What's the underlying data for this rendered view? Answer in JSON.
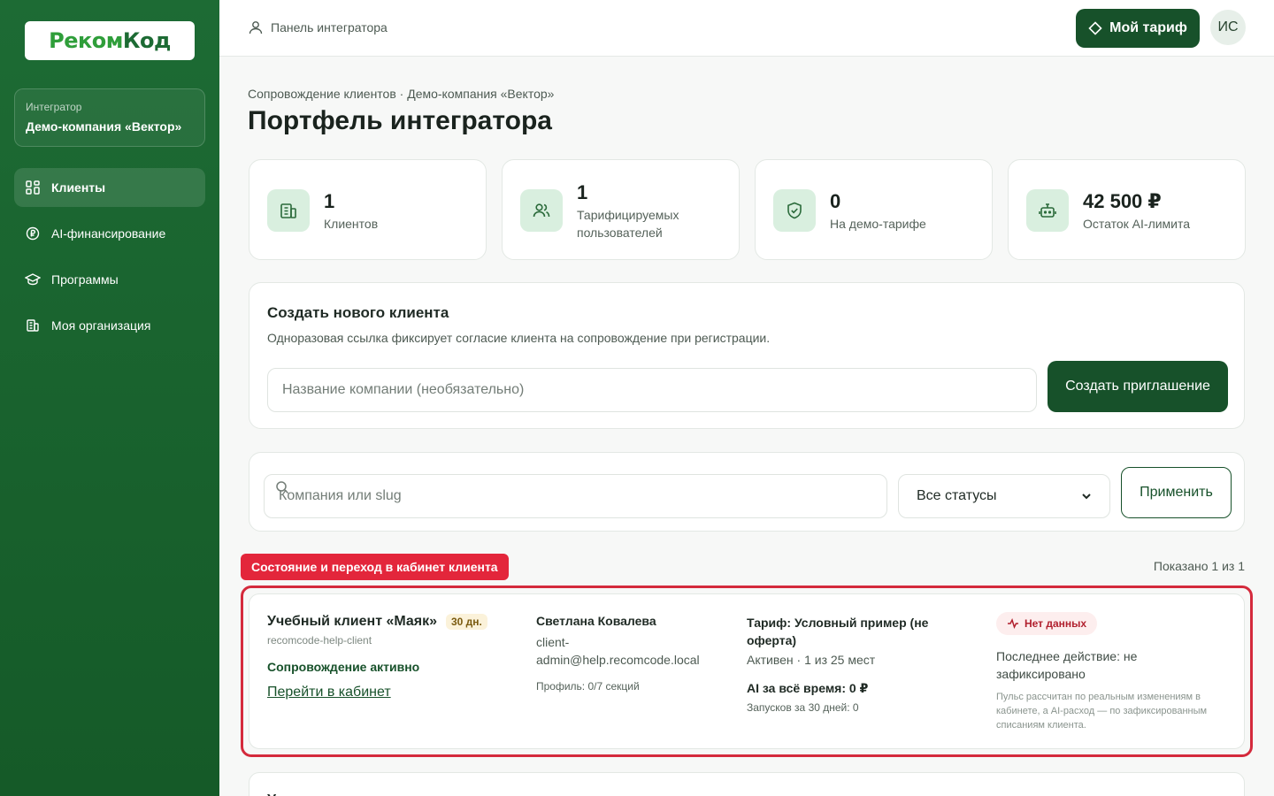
{
  "sidebar": {
    "logo": {
      "part1": "Реком",
      "part2": "Код"
    },
    "org_label": "Интегратор",
    "org_name": "Демо-компания «Вектор»",
    "items": [
      {
        "label": "Клиенты",
        "icon": "grid-icon",
        "active": true
      },
      {
        "label": "AI-финансирование",
        "icon": "coin-icon"
      },
      {
        "label": "Программы",
        "icon": "graduation-cap-icon"
      },
      {
        "label": "Моя организация",
        "icon": "building-icon"
      }
    ]
  },
  "topbar": {
    "panel_label": "Панель интегратора",
    "tariff_button": "Мой тариф",
    "avatar_initials": "ИС"
  },
  "page": {
    "breadcrumb": "Сопровождение клиентов · Демо-компания «Вектор»",
    "title": "Портфель интегратора"
  },
  "stats": [
    {
      "value": "1",
      "label": "Клиентов",
      "icon": "building-icon"
    },
    {
      "value": "1",
      "label": "Тарифицируемых пользователей",
      "icon": "users-icon"
    },
    {
      "value": "0",
      "label": "На демо-тарифе",
      "icon": "shield-check-icon"
    },
    {
      "value": "42 500 ₽",
      "label": "Остаток AI-лимита",
      "icon": "robot-icon"
    }
  ],
  "create": {
    "title": "Создать нового клиента",
    "subtitle": "Одноразовая ссылка фиксирует согласие клиента на сопровождение при регистрации.",
    "input_placeholder": "Название компании (необязательно)",
    "button": "Создать приглашение"
  },
  "filter": {
    "search_placeholder": "Компания или slug",
    "status_selected": "Все статусы",
    "apply_button": "Применить"
  },
  "list": {
    "section_tag": "Состояние и переход в кабинет клиента",
    "shown": "Показано 1 из 1"
  },
  "client": {
    "name": "Учебный клиент «Маяк»",
    "days": "30 дн.",
    "slug": "recomcode-help-client",
    "support_status": "Сопровождение активно",
    "cabinet_link": "Перейти в кабинет",
    "person": "Светлана Ковалева",
    "email": "client-admin@help.recomcode.local",
    "profile": "Профиль: 0/7 секций",
    "tariff": "Тариф: Условный пример (не оферта)",
    "active_line": "Активен · 1 из 25 мест",
    "ai_total": "AI за всё время: 0 ₽",
    "runs": "Запусков за 30 дней: 0",
    "nodata_badge": "Нет данных",
    "last_action": "Последнее действие: не зафиксировано",
    "pulse_note": "Пульс рассчитан по реальным изменениям в кабинете, а AI-расход — по зафиксированным списаниям клиента."
  },
  "next_client": {
    "name_fragment": "У"
  },
  "colors": {
    "sidebar": "#1d6b34",
    "primary": "#17512a",
    "danger": "#e3263b",
    "icon_bg": "#d9efdf"
  }
}
